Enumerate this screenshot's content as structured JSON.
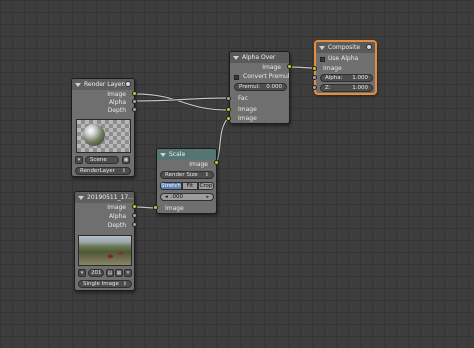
{
  "nodes": {
    "render_layers": {
      "title": "Render Layers",
      "outputs": [
        "Image",
        "Alpha",
        "Depth"
      ],
      "scene": "Scene",
      "layer": "RenderLayer"
    },
    "image": {
      "title": "20190511_17...",
      "outputs": [
        "Image",
        "Alpha",
        "Depth"
      ],
      "frame": "201",
      "source": "Single Image"
    },
    "scale": {
      "title": "Scale",
      "output": "Image",
      "space": "Render Size",
      "fit_modes": [
        "Stretch",
        "Fit",
        "Crop"
      ],
      "offset_value": ".000",
      "input": "Image"
    },
    "alpha_over": {
      "title": "Alpha Over",
      "output": "Image",
      "convert_premul": "Convert Premul",
      "premul_label": "Premul:",
      "premul_value": "0.000",
      "inputs": [
        "Fac",
        "Image",
        "Image"
      ]
    },
    "composite": {
      "title": "Composite",
      "use_alpha": "Use Alpha",
      "input": "Image",
      "alpha_label": "Alpha:",
      "alpha_value": "1.000",
      "z_label": "Z:",
      "z_value": "1.000"
    }
  },
  "colors": {
    "background": "#3d3d3d",
    "node_body": "#6f6f6f",
    "selected_border": "#e88c3c",
    "color_socket": "#c7c729",
    "value_socket": "#a4a4a4",
    "vector_socket": "#6363c7",
    "active_toggle": "#5d7fb4"
  }
}
